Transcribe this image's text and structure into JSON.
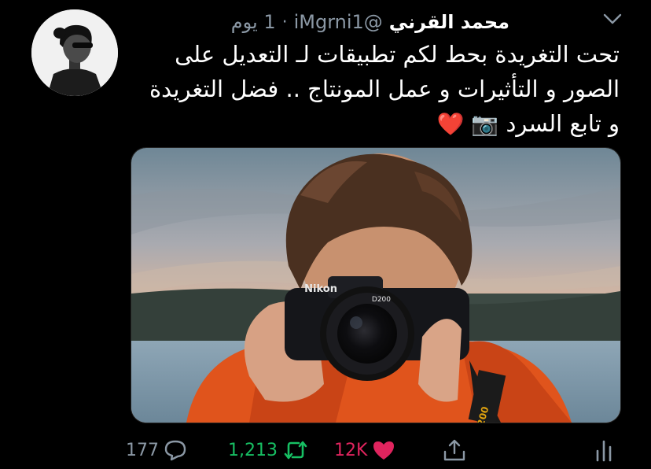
{
  "tweet": {
    "author_name": "محمد القرني",
    "handle": "@iMgrni1",
    "separator": "·",
    "time": "1 يوم",
    "text_lines": [
      "تحت التغريدة بحط لكم تطبيقات لـ التعديل على",
      "الصور و التأثيرات و عمل المونتاج .. فضل التغريدة",
      "و تابع السرد"
    ],
    "text_emojis": "📷 ❤️",
    "image": {
      "brand": "Nikon",
      "model": "D200"
    }
  },
  "actions": {
    "reply_count": "177",
    "retweet_count": "1,213",
    "like_count": "12K"
  },
  "icons": {
    "reply": "reply-icon",
    "retweet": "retweet-icon",
    "like": "heart-icon",
    "share": "share-icon",
    "stats": "stats-icon",
    "menu": "chevron-down-icon"
  },
  "colors": {
    "background": "#000000",
    "muted": "#8b98a5",
    "retweet_green": "#17bf63",
    "like_red": "#e0245e"
  }
}
